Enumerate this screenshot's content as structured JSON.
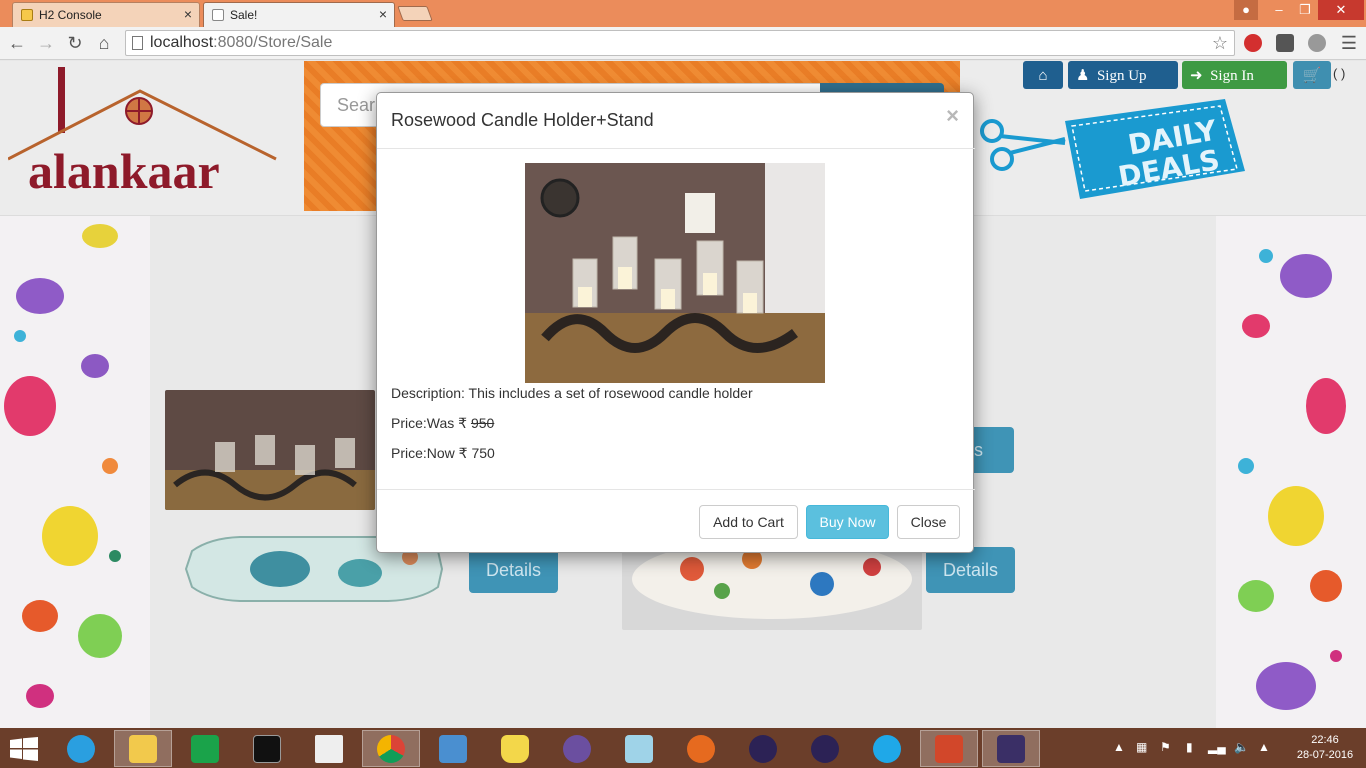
{
  "browser": {
    "tabs": [
      {
        "title": "H2 Console",
        "active": false
      },
      {
        "title": "Sale!",
        "active": true
      }
    ],
    "url_host": "localhost",
    "url_rest": ":8080/Store/Sale"
  },
  "site": {
    "logo_text": "alankaar",
    "search_placeholder": "Sear",
    "nav": {
      "signup_label": "Sign   Up",
      "signin_label": "Sign   In",
      "cart_count": "( )"
    },
    "deals_line1": "DAILY",
    "deals_line2": "DEALS",
    "details_labels": [
      "ails",
      "Details",
      "Details"
    ]
  },
  "modal": {
    "title": "Rosewood Candle Holder+Stand",
    "close_x": "×",
    "description": "Description: This includes a set of rosewood candle holder",
    "price_was_label": "Price:Was ₹ ",
    "price_was_value": "950",
    "price_now": "Price:Now ₹ 750",
    "buttons": {
      "add_to_cart": "Add to Cart",
      "buy_now": "Buy Now",
      "close": "Close"
    }
  },
  "taskbar": {
    "time": "22:46",
    "date": "28-07-2016",
    "apps": [
      "start-icon",
      "ie-icon",
      "file-explorer-icon",
      "store-icon",
      "cmd-icon",
      "book-icon",
      "chrome-icon",
      "remote-desktop-icon",
      "database-icon",
      "github-icon",
      "notepad-icon",
      "firefox-icon",
      "eclipse-icon",
      "eclipse-icon-2",
      "skype-icon",
      "powerpoint-icon",
      "java-ee-ide-icon"
    ]
  },
  "colors": {
    "title_bar": "#eb8c5b",
    "buy_now": "#5bc0de",
    "details_button": "#3f94b6",
    "taskbar": "#6b3e2a"
  }
}
